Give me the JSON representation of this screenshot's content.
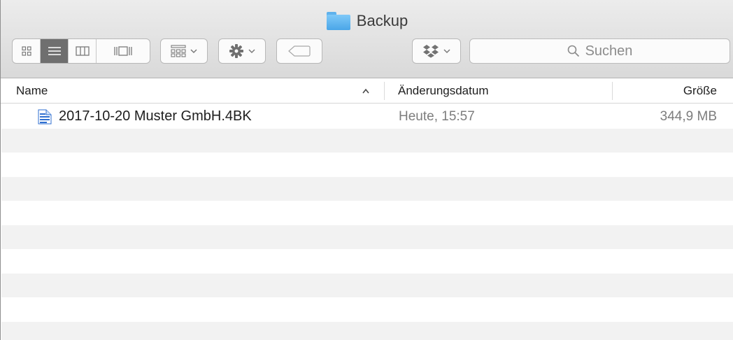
{
  "window": {
    "title": "Backup"
  },
  "toolbar": {
    "view_modes": [
      "icon-view",
      "list-view",
      "column-view",
      "cover-flow-view"
    ],
    "active_view": "list-view",
    "buttons": [
      "group-by-button",
      "action-button",
      "tag-button",
      "dropbox-button"
    ]
  },
  "search": {
    "placeholder": "Suchen"
  },
  "columns": {
    "name": "Name",
    "date": "Änderungsdatum",
    "size": "Größe",
    "sort_indicator": "^"
  },
  "files": [
    {
      "name": "2017-10-20 Muster GmbH.4BK",
      "modified": "Heute, 15:57",
      "size": "344,9 MB",
      "icon": "document-icon"
    }
  ],
  "colors": {
    "folder": "#5fb2ec",
    "document": "#2f6fd0",
    "active_segment": "#6f6f6f"
  }
}
